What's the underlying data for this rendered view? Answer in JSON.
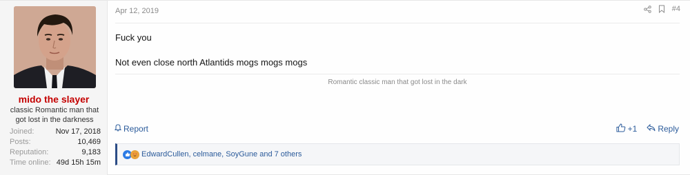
{
  "user": {
    "name": "mido the slayer",
    "title": "classic Romantic man that got lost in the darkness",
    "stats": [
      {
        "label": "Joined:",
        "value": "Nov 17, 2018"
      },
      {
        "label": "Posts:",
        "value": "10,469"
      },
      {
        "label": "Reputation:",
        "value": "9,183"
      },
      {
        "label": "Time online:",
        "value": "49d 15h 15m"
      }
    ]
  },
  "post": {
    "date": "Apr 12, 2019",
    "number": "#4",
    "message_lines": [
      "Fuck you",
      "Not even close north Atlantids mogs mogs mogs"
    ],
    "signature": "Romantic classic man that got lost in the dark"
  },
  "actions": {
    "report": "Report",
    "like_count": "+1",
    "reply": "Reply"
  },
  "reactions": {
    "text": "EdwardCullen, celmane, SoyGune and 7 others"
  },
  "colors": {
    "username": "#c40000",
    "link": "#2a5a9a",
    "reaction_border": "#2b4c86"
  }
}
